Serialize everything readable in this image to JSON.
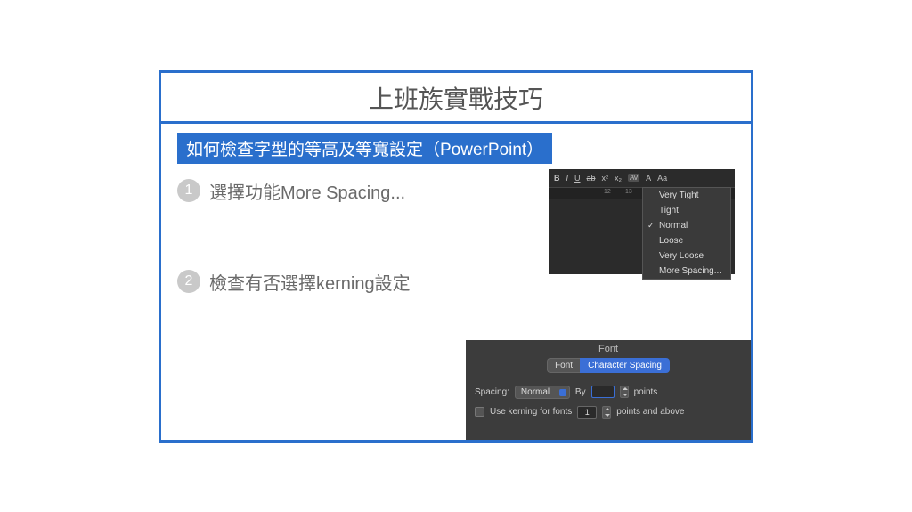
{
  "slide": {
    "title": "上班族實戰技巧",
    "subtitle": "如何檢查字型的等高及等寬設定（PowerPoint）",
    "steps": [
      {
        "num": "1",
        "text": "選擇功能More Spacing..."
      },
      {
        "num": "2",
        "text": "檢查有否選擇kerning設定"
      }
    ]
  },
  "shot1": {
    "toolbar": {
      "bold": "B",
      "italic": "I",
      "underline": "U",
      "strike": "ab",
      "sup": "x²",
      "sub": "x₂",
      "av": "AV",
      "caseA": "A",
      "case_aa": "Aa"
    },
    "ruler": {
      "t12": "12",
      "t13": "13"
    },
    "menu": [
      "Very Tight",
      "Tight",
      "Normal",
      "Loose",
      "Very Loose",
      "More Spacing..."
    ],
    "menu_checked_index": 2
  },
  "shot2": {
    "panel_title": "Font",
    "tabs": {
      "font": "Font",
      "spacing": "Character Spacing"
    },
    "row1": {
      "label": "Spacing:",
      "select": "Normal",
      "by": "By",
      "value": "",
      "unit": "points"
    },
    "row2": {
      "label": "Use kerning for fonts",
      "value": "1",
      "unit": "points and above"
    }
  }
}
